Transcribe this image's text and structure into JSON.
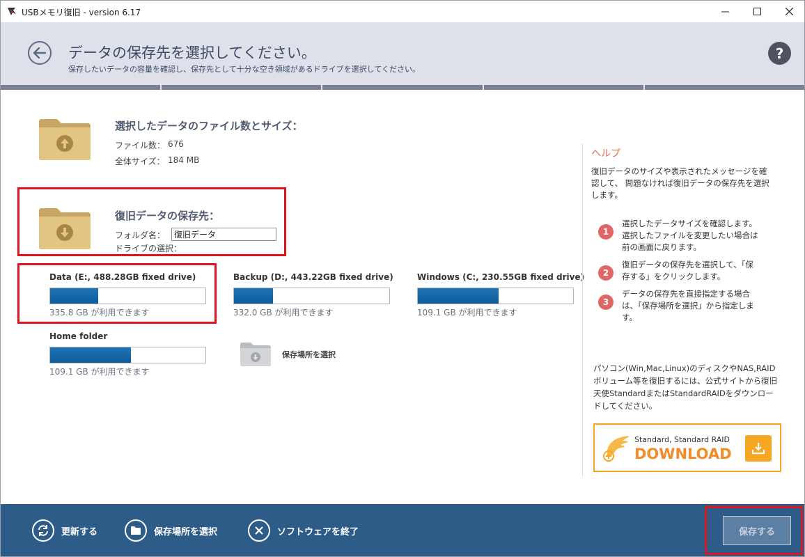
{
  "window": {
    "title": "USBメモリ復旧 - version 6.17",
    "minimize": "—",
    "maximize": "☐",
    "close": "✕"
  },
  "header": {
    "title": "データの保存先を選択してください。",
    "subtitle": "保存したいデータの容量を確認し、保存先として十分な空き領域があるドライブを選択してください。",
    "help": "?"
  },
  "selected_data": {
    "heading": "選択したデータのファイル数とサイズ：",
    "file_count_label": "ファイル数：",
    "file_count": "676",
    "total_size_label": "全体サイズ：",
    "total_size": "184 MB"
  },
  "destination": {
    "heading": "復旧データの保存先：",
    "folder_name_label": "フォルダ名：",
    "folder_name_value": "復旧データ",
    "drive_select_label": "ドライブの選択："
  },
  "drives": [
    {
      "name": "Data (E:, 488.28GB fixed drive)",
      "free": "335.8 GB が利用できます",
      "used_fraction": 0.31
    },
    {
      "name": "Backup (D:, 443.22GB fixed drive)",
      "free": "332.0 GB が利用できます",
      "used_fraction": 0.25
    },
    {
      "name": "Windows (C:, 230.55GB fixed drive)",
      "free": "109.1 GB が利用できます",
      "used_fraction": 0.52
    },
    {
      "name": "Home folder",
      "free": "109.1 GB が利用できます",
      "used_fraction": 0.52
    }
  ],
  "choose_location": {
    "label": "保存場所を選択"
  },
  "help": {
    "title": "ヘルプ",
    "intro": "復旧データのサイズや表示されたメッセージを確認して、 問題なければ復旧データの保存先を選択します。",
    "steps": [
      {
        "num": "1",
        "text": "選択したデータサイズを確認します。選択したファイルを変更したい場合は前の画面に戻ります。"
      },
      {
        "num": "2",
        "text": "復旧データの保存先を選択して、「保存する」をクリックします。"
      },
      {
        "num": "3",
        "text": "データの保存先を直接指定する場合は、「保存場所を選択」から指定します。"
      }
    ],
    "note": "パソコン(Win,Mac,Linux)のディスクやNAS,RAIDボリューム等を復旧するには、公式サイトから復旧天使StandardまたはStandardRAIDをダウンロードしてください。",
    "download_line1": "Standard, Standard RAID",
    "download_line2": "DOWNLOAD"
  },
  "footer": {
    "refresh": "更新する",
    "choose_location": "保存場所を選択",
    "exit": "ソフトウェアを終了",
    "save": "保存する"
  },
  "colors": {
    "accent": "#2d5c89",
    "highlight": "#e0141e",
    "drive_bar": "#1565a8",
    "download": "#f5a623"
  }
}
